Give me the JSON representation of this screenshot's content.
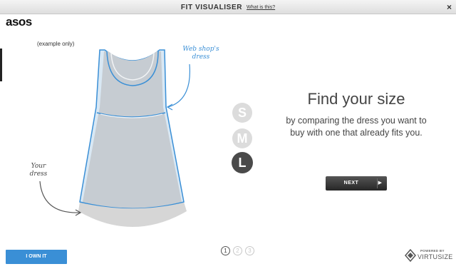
{
  "titlebar": {
    "title": "FIT VISUALISER",
    "help_link": "What is this?",
    "close_glyph": "×"
  },
  "brand": {
    "logo": "asos"
  },
  "illustration": {
    "note": "(example only)",
    "webshop_label_line1": "Web shop's",
    "webshop_label_line2": "dress",
    "your_label_line1": "Your",
    "your_label_line2": "dress",
    "colors": {
      "webshop_outline": "#3a8fd6",
      "your_dress": "#c6ccd2",
      "shadow": "#d6d6d6"
    }
  },
  "sizes": [
    {
      "label": "S",
      "selected": false
    },
    {
      "label": "M",
      "selected": false
    },
    {
      "label": "L",
      "selected": true
    }
  ],
  "main": {
    "headline": "Find your size",
    "subtext_line1": "by comparing the dress you want to",
    "subtext_line2": "buy with one that already fits you."
  },
  "buttons": {
    "next_label": "NEXT",
    "next_arrow": "▶",
    "own_label": "I OWN IT"
  },
  "steps": {
    "items": [
      "1",
      "2",
      "3"
    ],
    "current": 1
  },
  "footer": {
    "powered_small": "POWERED BY",
    "powered_brand": "VIRTUSIZE",
    "icon": "virtusize-logo-icon"
  },
  "colors": {
    "accent": "#3a8fd6",
    "button_dark": "#333333",
    "size_inactive": "#dcdcdc",
    "size_active": "#4a4a4a"
  }
}
